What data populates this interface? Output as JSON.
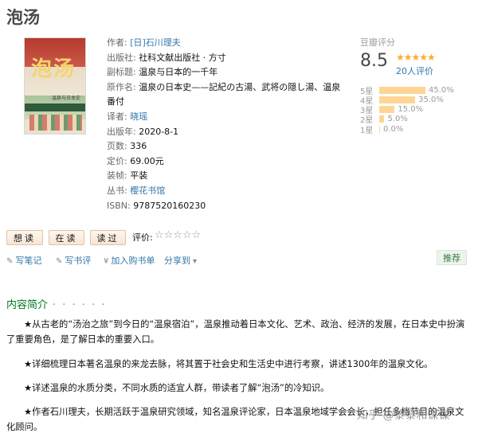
{
  "book": {
    "title": "泡汤",
    "cover_title": "泡汤",
    "cover_subtitle": "温泉与日本史",
    "info": [
      {
        "label": "作者:",
        "value": "[日]石川理夫",
        "link": true
      },
      {
        "label": "出版社:",
        "value": "社科文献出版社 · 方寸",
        "link": false
      },
      {
        "label": "副标题:",
        "value": "温泉与日本的一千年",
        "link": false
      },
      {
        "label": "原作名:",
        "value": "温泉の日本史——記紀の古湯、武将の隠し湯、温泉番付",
        "link": false
      },
      {
        "label": "译者:",
        "value": "晓瑶",
        "link": true
      },
      {
        "label": "出版年:",
        "value": "2020-8-1",
        "link": false
      },
      {
        "label": "页数:",
        "value": "336",
        "link": false
      },
      {
        "label": "定价:",
        "value": "69.00元",
        "link": false
      },
      {
        "label": "装帧:",
        "value": "平装",
        "link": false
      },
      {
        "label": "丛书:",
        "value": "樱花书馆",
        "link": true
      },
      {
        "label": "ISBN:",
        "value": "9787520160230",
        "link": false
      }
    ]
  },
  "rating": {
    "label": "豆瓣评分",
    "score": "8.5",
    "stars": "★★★★★",
    "count": "20人评价",
    "distribution": [
      {
        "label": "5星",
        "percent_text": "45.0%",
        "percent": 45.0
      },
      {
        "label": "4星",
        "percent_text": "35.0%",
        "percent": 35.0
      },
      {
        "label": "3星",
        "percent_text": "15.0%",
        "percent": 15.0
      },
      {
        "label": "2星",
        "percent_text": "5.0%",
        "percent": 5.0
      },
      {
        "label": "1星",
        "percent_text": "0.0%",
        "percent": 0.0
      }
    ]
  },
  "actions": {
    "want": "想读",
    "reading": "在读",
    "read": "读过",
    "rate_label": "评价:",
    "rate_stars": "☆☆☆☆☆",
    "write_note": "写笔记",
    "write_review": "写书评",
    "add_cart": "加入购书单",
    "share": "分享到",
    "recommend": "推荐"
  },
  "intro": {
    "heading": "内容简介",
    "dots": "· · · · · ·",
    "paragraphs": [
      "★从古老的“汤治之旅”到今日的“温泉宿泊”，温泉推动着日本文化、艺术、政治、经济的发展，在日本史中扮演了重要角色，是了解日本的重要入口。",
      "★详细梳理日本著名温泉的来龙去脉，将其置于社会史和生活史中进行考察，讲述1300年的温泉文化。",
      "★详述温泉的水质分类，不同水质的适宜人群，带读者了解“泡汤”的冷知识。",
      "★作者石川理夫，长期活跃于温泉研究领域，知名温泉评论家，日本温泉地域学会会长，担任多档节目的温泉文化顾问。"
    ]
  },
  "watermark": "知乎 @黎黎和谋谋",
  "colors": {
    "link": "#3377aa",
    "accent_green": "#007722",
    "star": "#ffac2d",
    "bar": "#ffd596"
  }
}
